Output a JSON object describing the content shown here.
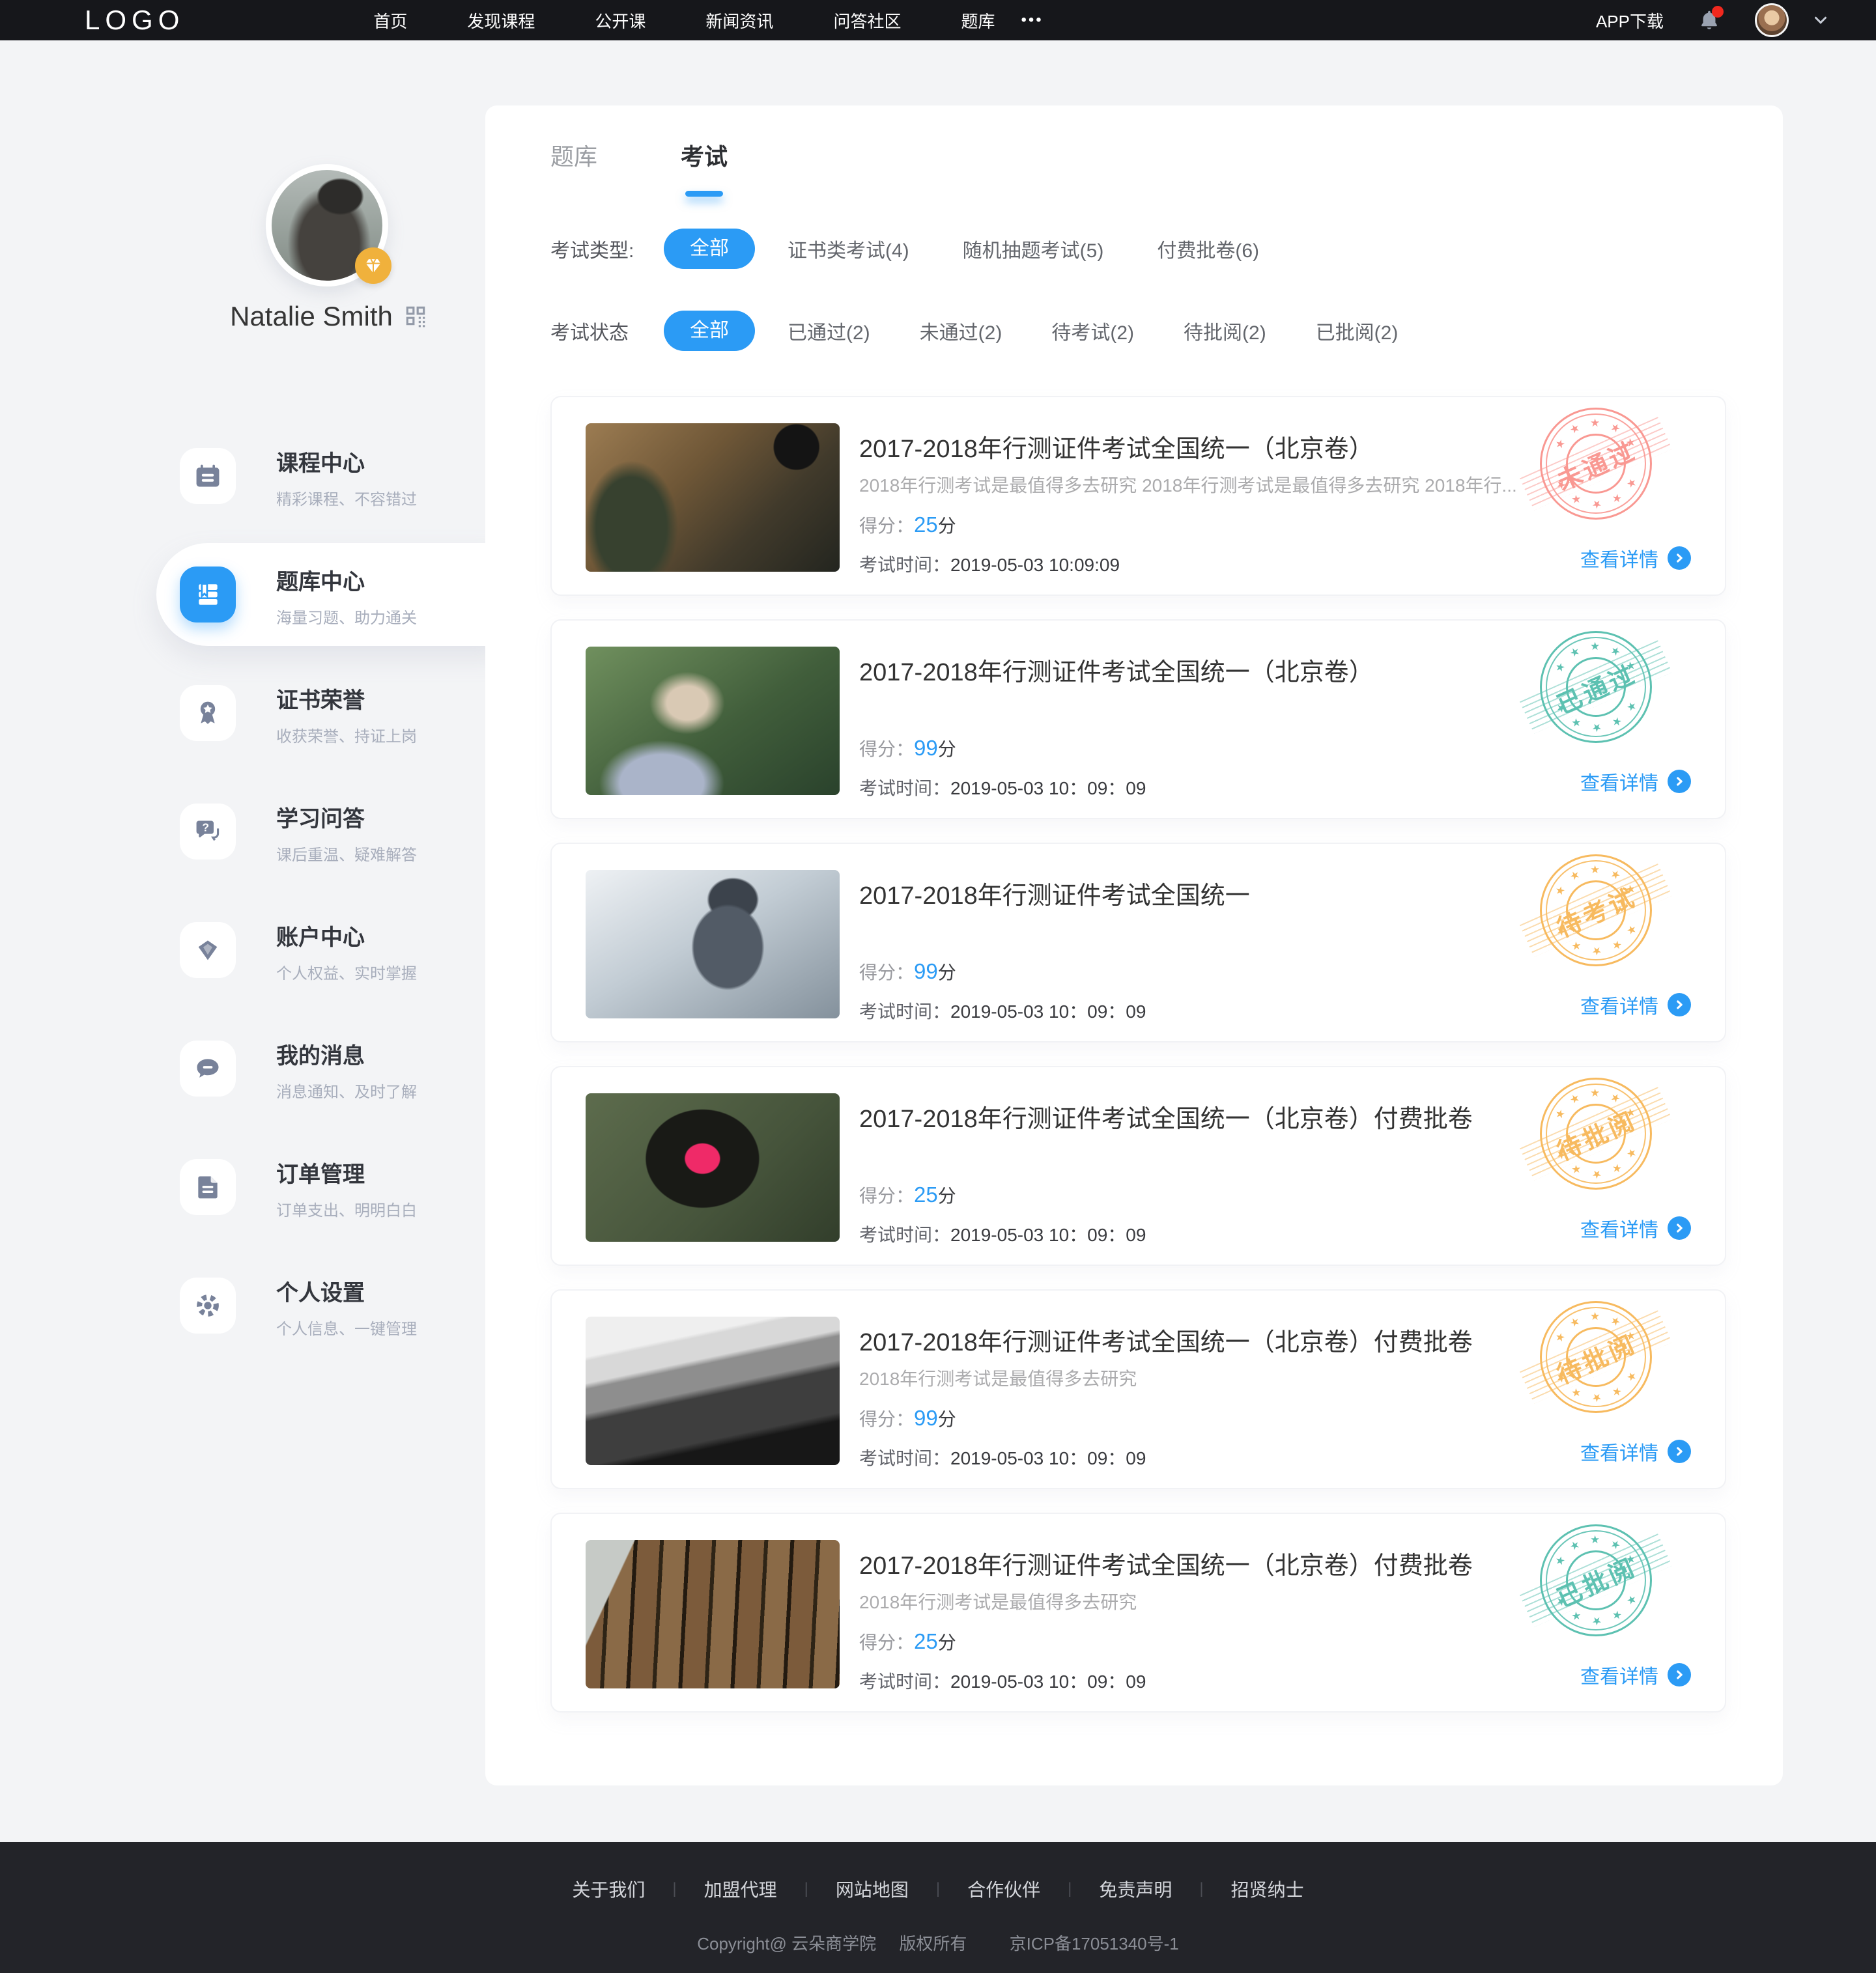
{
  "header": {
    "logo": "LOGO",
    "nav": [
      "首页",
      "发现课程",
      "公开课",
      "新闻资讯",
      "问答社区",
      "题库"
    ],
    "more": "•••",
    "app_download": "APP下载"
  },
  "profile": {
    "name": "Natalie Smith"
  },
  "sidebar": {
    "items": [
      {
        "title": "课程中心",
        "subtitle": "精彩课程、不容错过"
      },
      {
        "title": "题库中心",
        "subtitle": "海量习题、助力通关",
        "active": true
      },
      {
        "title": "证书荣誉",
        "subtitle": "收获荣誉、持证上岗"
      },
      {
        "title": "学习问答",
        "subtitle": "课后重温、疑难解答"
      },
      {
        "title": "账户中心",
        "subtitle": "个人权益、实时掌握"
      },
      {
        "title": "我的消息",
        "subtitle": "消息通知、及时了解"
      },
      {
        "title": "订单管理",
        "subtitle": "订单支出、明明白白"
      },
      {
        "title": "个人设置",
        "subtitle": "个人信息、一键管理"
      }
    ]
  },
  "main": {
    "tabs": [
      {
        "label": "题库",
        "active": false
      },
      {
        "label": "考试",
        "active": true
      }
    ],
    "filter_type": {
      "label": "考试类型:",
      "selected": "全部",
      "options": [
        "全部",
        "证书类考试(4)",
        "随机抽题考试(5)",
        "付费批卷(6)"
      ]
    },
    "filter_status": {
      "label": "考试状态",
      "selected": "全部",
      "options": [
        "全部",
        "已通过(2)",
        "未通过(2)",
        "待考试(2)",
        "待批阅(2)",
        "已批阅(2)"
      ]
    },
    "labels": {
      "score": "得分：",
      "score_unit": "分",
      "time": "考试时间：",
      "detail": "查看详情"
    },
    "exams": [
      {
        "title": "2017-2018年行测证件考试全国统一（北京卷）",
        "desc": "2018年行测考试是最值得多去研究 2018年行测考试是最值得多去研究 2018年行...",
        "score": "25",
        "time": "2019-05-03  10:09:09",
        "stamp": "未通过",
        "status": "fail"
      },
      {
        "title": "2017-2018年行测证件考试全国统一（北京卷）",
        "desc": "",
        "score": "99",
        "time": "2019-05-03  10：09：09",
        "stamp": "已通过",
        "status": "pass"
      },
      {
        "title": "2017-2018年行测证件考试全国统一",
        "desc": "",
        "score": "99",
        "time": "2019-05-03  10：09：09",
        "stamp": "待考试",
        "status": "upcoming"
      },
      {
        "title": "2017-2018年行测证件考试全国统一（北京卷）付费批卷",
        "desc": "",
        "score": "25",
        "time": "2019-05-03  10：09：09",
        "stamp": "待批阅",
        "status": "to-review"
      },
      {
        "title": "2017-2018年行测证件考试全国统一（北京卷）付费批卷",
        "desc": "2018年行测考试是最值得多去研究",
        "score": "99",
        "time": "2019-05-03  10：09：09",
        "stamp": "待批阅",
        "status": "to-review"
      },
      {
        "title": "2017-2018年行测证件考试全国统一（北京卷）付费批卷",
        "desc": "2018年行测考试是最值得多去研究",
        "score": "25",
        "time": "2019-05-03  10：09：09",
        "stamp": "已批阅",
        "status": "reviewed"
      }
    ]
  },
  "footer": {
    "links": [
      "关于我们",
      "加盟代理",
      "网站地图",
      "合作伙伴",
      "免责声明",
      "招贤纳士"
    ],
    "separator": "|",
    "copyright": [
      "Copyright@ 云朵商学院",
      "版权所有",
      "京ICP备17051340号-1"
    ]
  },
  "colors": {
    "accent": "#2b9bf5",
    "navbar_bg": "#16171b",
    "footer_bg": "#232429",
    "page_bg": "#f3f4f6",
    "stamp_fail": "#f8827b",
    "stamp_pass": "#3ab4a1",
    "stamp_pending": "#f6ac3d",
    "badge_vip": "#f0b13c",
    "notification_dot": "#f0281e"
  }
}
